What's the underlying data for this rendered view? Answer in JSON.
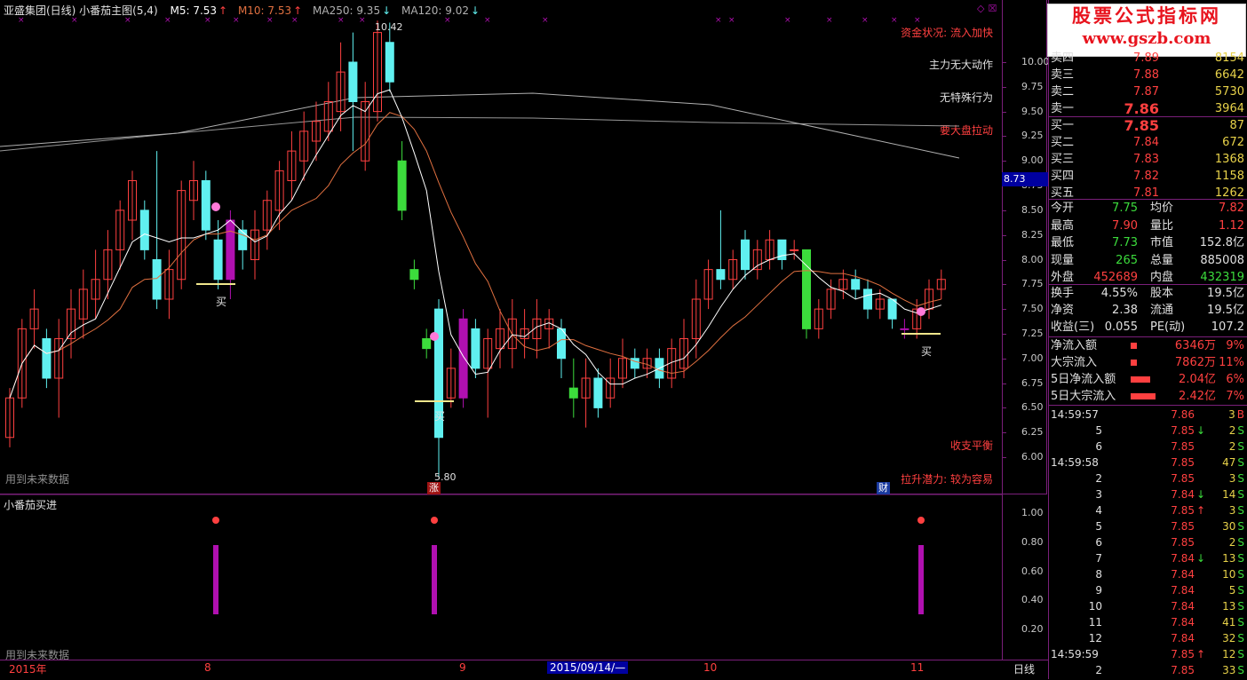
{
  "header": {
    "title": "亚盛集团(日线) 小番茄主图(5,4)",
    "ma5": "M5: 7.53",
    "ma10": "M10: 7.53",
    "ma250": "MA250: 9.35",
    "ma120": "MA120: 9.02"
  },
  "watermark": {
    "line1": "股票公式指标网",
    "line2": "www.gszb.com"
  },
  "notes": {
    "fund_status": "资金状况: 流入加快",
    "main_force": "主力无大动作",
    "no_special": "无特殊行为",
    "pull_up": "要大盘拉动",
    "balance": "收支平衡",
    "lift_potential": "拉升潜力: 较为容易",
    "future_data_main": "用到未来数据",
    "future_data_sub": "用到未来数据",
    "sub_title": "小番茄买进",
    "buy": "买",
    "high_mark": "10.42",
    "low_mark": "5.80",
    "zhang_tag": "涨",
    "cai_tag": "财",
    "current_price_tag": "8.73"
  },
  "axis": {
    "main_ticks": [
      "10.00",
      "9.75",
      "9.50",
      "9.25",
      "9.00",
      "8.75",
      "8.50",
      "8.25",
      "8.00",
      "7.75",
      "7.50",
      "7.25",
      "7.00",
      "6.75",
      "6.50",
      "6.25",
      "6.00"
    ],
    "sub_ticks": [
      "1.00",
      "0.80",
      "0.60",
      "0.40",
      "0.20"
    ]
  },
  "dates": {
    "d1": "2015年",
    "d2": "8",
    "d3": "9",
    "d4": "2015/09/14/—",
    "d5": "10",
    "d6": "11",
    "period": "日线"
  },
  "colors": {
    "up": "#ff4040",
    "down": "#60f0f0",
    "border": "#7a1f7a",
    "ma5": "#ffffff",
    "ma10": "#e07040",
    "ma_long": "#b0b0b0",
    "signal": "#b010b0"
  },
  "orderbook": {
    "sells": [
      {
        "label": "卖四",
        "price": "7.89",
        "vol": "8154"
      },
      {
        "label": "卖三",
        "price": "7.88",
        "vol": "6642"
      },
      {
        "label": "卖二",
        "price": "7.87",
        "vol": "5730"
      },
      {
        "label": "卖一",
        "price": "7.86",
        "vol": "3964"
      }
    ],
    "buys": [
      {
        "label": "买一",
        "price": "7.85",
        "vol": "87"
      },
      {
        "label": "买二",
        "price": "7.84",
        "vol": "672"
      },
      {
        "label": "买三",
        "price": "7.83",
        "vol": "1368"
      },
      {
        "label": "买四",
        "price": "7.82",
        "vol": "1158"
      },
      {
        "label": "买五",
        "price": "7.81",
        "vol": "1262"
      }
    ]
  },
  "stats": [
    {
      "l1": "今开",
      "v1": "7.75",
      "l2": "均价",
      "v2": "7.82"
    },
    {
      "l1": "最高",
      "v1": "7.90",
      "l2": "量比",
      "v2": "1.12"
    },
    {
      "l1": "最低",
      "v1": "7.73",
      "l2": "市值",
      "v2": "152.8亿"
    },
    {
      "l1": "现量",
      "v1": "265",
      "l2": "总量",
      "v2": "885008"
    },
    {
      "l1": "外盘",
      "v1": "452689",
      "l2": "内盘",
      "v2": "432319"
    }
  ],
  "stats2": [
    {
      "l1": "换手",
      "v1": "4.55%",
      "l2": "股本",
      "v2": "19.5亿"
    },
    {
      "l1": "净资",
      "v1": "2.38",
      "l2": "流通",
      "v2": "19.5亿"
    },
    {
      "l1": "收益(三)",
      "v1": "0.055",
      "l2": "PE(动)",
      "v2": "107.2"
    }
  ],
  "flows": [
    {
      "label": "净流入额",
      "value": "6346万",
      "pct": "9%",
      "bar": 0.1
    },
    {
      "label": "大宗流入",
      "value": "7862万",
      "pct": "11%",
      "bar": 0.1
    },
    {
      "label": "5日净流入额",
      "value": "2.04亿",
      "pct": "6%",
      "bar": 0.6
    },
    {
      "label": "5日大宗流入",
      "value": "2.42亿",
      "pct": "7%",
      "bar": 0.8
    }
  ],
  "ticks": [
    {
      "t": "14:59:57",
      "p": "7.86",
      "v": "3",
      "s": "B",
      "dir": ""
    },
    {
      "t": "5",
      "p": "7.85",
      "v": "2",
      "s": "S",
      "dir": "down"
    },
    {
      "t": "6",
      "p": "7.85",
      "v": "2",
      "s": "S",
      "dir": ""
    },
    {
      "t": "14:59:58",
      "p": "7.85",
      "v": "47",
      "s": "S",
      "dir": ""
    },
    {
      "t": "2",
      "p": "7.85",
      "v": "3",
      "s": "S",
      "dir": ""
    },
    {
      "t": "3",
      "p": "7.84",
      "v": "14",
      "s": "S",
      "dir": "down"
    },
    {
      "t": "4",
      "p": "7.85",
      "v": "3",
      "s": "S",
      "dir": "up"
    },
    {
      "t": "5",
      "p": "7.85",
      "v": "30",
      "s": "S",
      "dir": ""
    },
    {
      "t": "6",
      "p": "7.85",
      "v": "2",
      "s": "S",
      "dir": ""
    },
    {
      "t": "7",
      "p": "7.84",
      "v": "13",
      "s": "S",
      "dir": "down"
    },
    {
      "t": "8",
      "p": "7.84",
      "v": "10",
      "s": "S",
      "dir": ""
    },
    {
      "t": "9",
      "p": "7.84",
      "v": "5",
      "s": "S",
      "dir": ""
    },
    {
      "t": "10",
      "p": "7.84",
      "v": "13",
      "s": "S",
      "dir": ""
    },
    {
      "t": "11",
      "p": "7.84",
      "v": "41",
      "s": "S",
      "dir": ""
    },
    {
      "t": "12",
      "p": "7.84",
      "v": "32",
      "s": "S",
      "dir": ""
    },
    {
      "t": "14:59:59",
      "p": "7.85",
      "v": "12",
      "s": "S",
      "dir": "up"
    },
    {
      "t": "2",
      "p": "7.85",
      "v": "33",
      "s": "S",
      "dir": ""
    }
  ]
}
